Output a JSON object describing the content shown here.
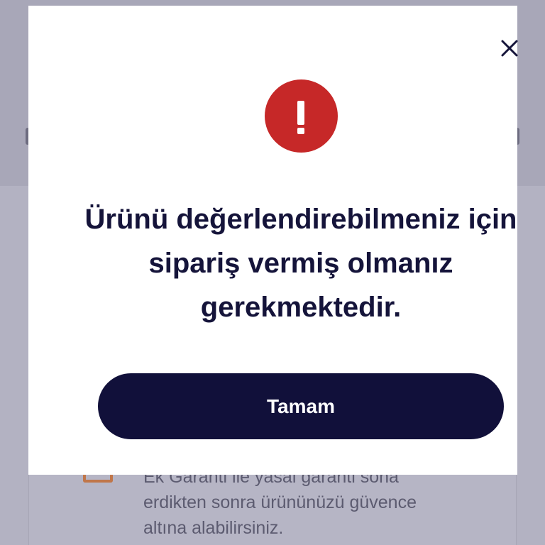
{
  "dialog": {
    "close_icon": "close-icon",
    "alert_icon": "exclamation-circle-icon",
    "message": "Ürünü değerlendirebilmeniz için sipariş vermiş olmanız gerekmektedir.",
    "button_label": "Tamam",
    "colors": {
      "alert": "#c62828",
      "button": "#11103a",
      "text": "#15143a"
    }
  },
  "background": {
    "warranty_text_lines": [
      "Ek Garanti ile yasal garanti sona",
      "erdikten sonra ürününüzü güvence",
      "altına alabilirsiniz."
    ]
  }
}
